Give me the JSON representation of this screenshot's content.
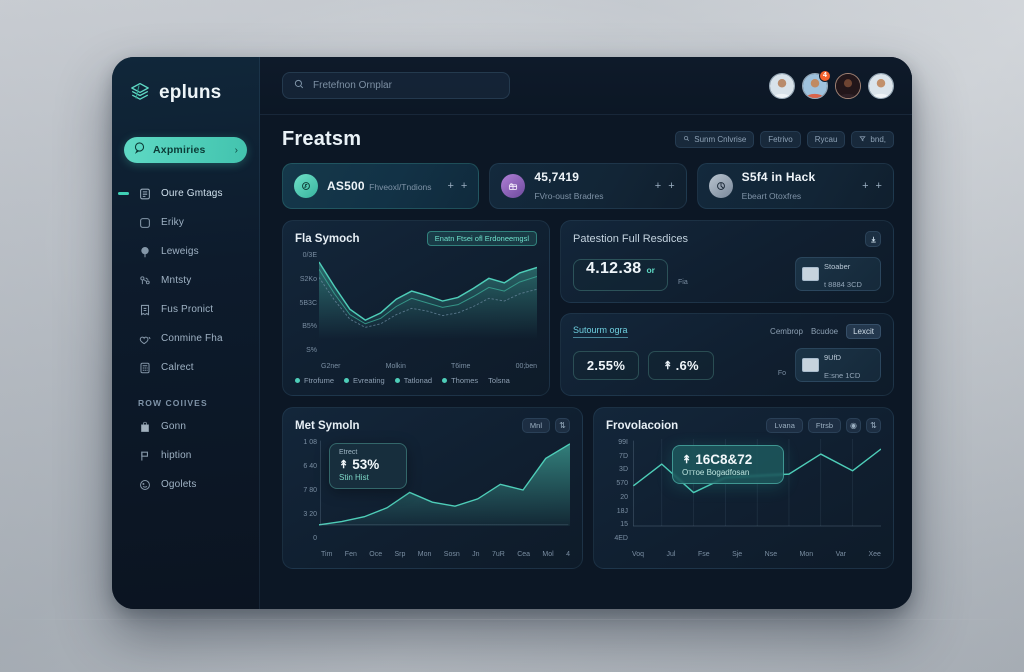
{
  "brand": {
    "name": "epluns",
    "logo_icon": "layered-diamond-icon",
    "accent": "#4ecdb8"
  },
  "sidebar": {
    "primary": {
      "label": "Axpmiries",
      "icon": "chat-bubble-icon",
      "chevron": "›"
    },
    "items": [
      {
        "label": "Oure Gmtags",
        "icon": "calendar-icon",
        "active": true
      },
      {
        "label": "Eriky",
        "icon": "book-icon",
        "active": false
      },
      {
        "label": "Leweigs",
        "icon": "balloon-icon",
        "active": false
      },
      {
        "label": "Mntsty",
        "icon": "molecule-icon",
        "active": false
      },
      {
        "label": "Fus Pronict",
        "icon": "receipt-icon",
        "active": false
      },
      {
        "label": "Conmine Fha",
        "icon": "heart-hands-icon",
        "active": false
      },
      {
        "label": "Calrect",
        "icon": "calculator-icon",
        "active": false
      }
    ],
    "section_label": "ROW COIIVES",
    "section_items": [
      {
        "label": "Gonn",
        "icon": "bag-icon"
      },
      {
        "label": "hiption",
        "icon": "flag-icon"
      },
      {
        "label": "Ogolets",
        "icon": "smiley-icon"
      }
    ]
  },
  "topbar": {
    "search_placeholder": "Fretefnon Ornplar",
    "search_icon": "search-icon",
    "avatars": [
      {
        "name": "avatar-1",
        "badge": ""
      },
      {
        "name": "avatar-2",
        "badge": "4"
      },
      {
        "name": "avatar-3",
        "badge": ""
      },
      {
        "name": "avatar-4",
        "badge": ""
      }
    ]
  },
  "page": {
    "title": "Freatsm",
    "head_buttons": [
      {
        "label": "Sunm Cnlvrise",
        "icon": "search-icon"
      },
      {
        "label": "Fetrivo",
        "icon": ""
      },
      {
        "label": "Rycau",
        "icon": ""
      },
      {
        "label": "bnd,",
        "icon": "filter-icon"
      }
    ]
  },
  "stats": [
    {
      "value": "AS500",
      "sub": "Fhveoxl/Tndions",
      "icon": "coin-icon",
      "accent": "#4ecdb8",
      "actions": [
        "+",
        "+"
      ]
    },
    {
      "value": "45,7419",
      "sub": "FVro-oust Bradres",
      "icon": "gift-icon",
      "accent": "#8a63d2",
      "actions": [
        "+",
        "+"
      ]
    },
    {
      "value": "S5f4 in Hack",
      "sub": "Ebeart Otoxfres",
      "icon": "pie-icon",
      "accent": "#9aa7b4",
      "actions": [
        "+",
        "+"
      ]
    }
  ],
  "chart_card": {
    "title": "Fla Symoch",
    "badge": "Enatn Ftsei ofl Erdoneemgsl",
    "legend": [
      {
        "label": "Ftrofume",
        "color": "#4ecdb8"
      },
      {
        "label": "Evreating",
        "color": "#4ecdb8"
      },
      {
        "label": "Tatlonad",
        "color": "#4ecdb8"
      },
      {
        "label": "Thomes",
        "color": "#4ecdb8"
      },
      {
        "label": "Tolsna",
        "color": "#7a8ea2"
      }
    ]
  },
  "panel_top": {
    "title": "Patestion Full Resdices",
    "icon": "download-icon",
    "value": "4.12.38",
    "unit": "or",
    "mini_prefix": "Fia",
    "mini_title": "Stoaber",
    "mini_sub": "t 8884 3CD"
  },
  "panel_bottom": {
    "link": "Sutourm ogra",
    "tabs": [
      {
        "label": "Cembrop",
        "selected": false
      },
      {
        "label": "Bcudoe",
        "selected": false
      },
      {
        "label": "Lexcit",
        "selected": true
      }
    ],
    "values": [
      {
        "value": "2.55%",
        "arrow": ""
      },
      {
        "value": ".6%",
        "arrow": "↟"
      }
    ],
    "mini_prefix": "Fo",
    "mini_title": "9UfD",
    "mini_sub": "E:sne 1CD"
  },
  "bottom_left": {
    "title": "Met Symoln",
    "buttons": [
      {
        "label": "Mnl",
        "type": "pill"
      },
      {
        "label": "⇅",
        "type": "icon"
      }
    ],
    "tooltip": {
      "caption": "Etrect",
      "value": "53%",
      "arrow": "↟",
      "sub": "Stin Hist"
    }
  },
  "bottom_right": {
    "title": "Frovolacoion",
    "buttons": [
      {
        "label": "Lvana",
        "type": "pill"
      },
      {
        "label": "Ftrsb",
        "type": "pill"
      },
      {
        "label": "◉",
        "type": "icon"
      },
      {
        "label": "⇅",
        "type": "icon"
      }
    ],
    "tooltip": {
      "value": "16С8&72",
      "arrow": "↟",
      "sub": "Оттое Bogadfosan"
    }
  },
  "chart_data": [
    {
      "type": "line",
      "title": "Fla Symoch",
      "id": "fla-symoch",
      "ylabel": "",
      "xlabel": "",
      "yticks": [
        "0/3E",
        "S2Ko",
        "5B3C",
        "B5%",
        "S%"
      ],
      "xticks": [
        "G2ner",
        "Molkin",
        "T6ime",
        "00;ben"
      ],
      "ylim": [
        0,
        100
      ],
      "grid": false,
      "series": [
        {
          "name": "Ftrofume",
          "color": "#4ecdb8",
          "values": [
            88,
            60,
            34,
            22,
            30,
            46,
            55,
            50,
            44,
            48,
            58,
            70,
            64,
            76,
            82
          ]
        },
        {
          "name": "Evreating",
          "color": "#3fae9c",
          "values": [
            80,
            52,
            28,
            18,
            24,
            38,
            46,
            42,
            36,
            40,
            50,
            60,
            56,
            66,
            72
          ]
        },
        {
          "name": "Tatlonad",
          "color": "#6f8ba0",
          "values": [
            70,
            44,
            24,
            15,
            20,
            31,
            38,
            35,
            30,
            33,
            41,
            50,
            47,
            56,
            62
          ]
        }
      ]
    },
    {
      "type": "area",
      "title": "Met Symoln",
      "id": "met-symoln",
      "yticks": [
        "1 08",
        "6 40",
        "7 80",
        "3 20",
        "0"
      ],
      "xticks": [
        "Tim",
        "Fen",
        "Oce",
        "Srp",
        "Mon",
        "Sosn",
        "Jn",
        "7uR",
        "Cea",
        "Mol",
        "4"
      ],
      "ylim": [
        0,
        108
      ],
      "grid": false,
      "series": [
        {
          "name": "Met",
          "color": "#4ecdb8",
          "values": [
            2,
            6,
            12,
            22,
            40,
            30,
            26,
            34,
            50,
            44,
            78,
            96
          ]
        }
      ]
    },
    {
      "type": "line",
      "title": "Frovolacoion",
      "id": "frovolacoion",
      "yticks": [
        "99I",
        "7D",
        "3D",
        "570",
        "20",
        "18J",
        "15",
        "4ED"
      ],
      "xticks": [
        "Voq",
        "Jul",
        "Fse",
        "Sje",
        "Nse",
        "Mon",
        "Var",
        "Xee"
      ],
      "ylim": [
        0,
        100
      ],
      "grid": true,
      "series": [
        {
          "name": "Frovolacoion",
          "color": "#4ecdb8",
          "values": [
            52,
            72,
            40,
            50,
            62,
            60,
            58,
            84,
            66,
            90
          ]
        }
      ]
    }
  ]
}
